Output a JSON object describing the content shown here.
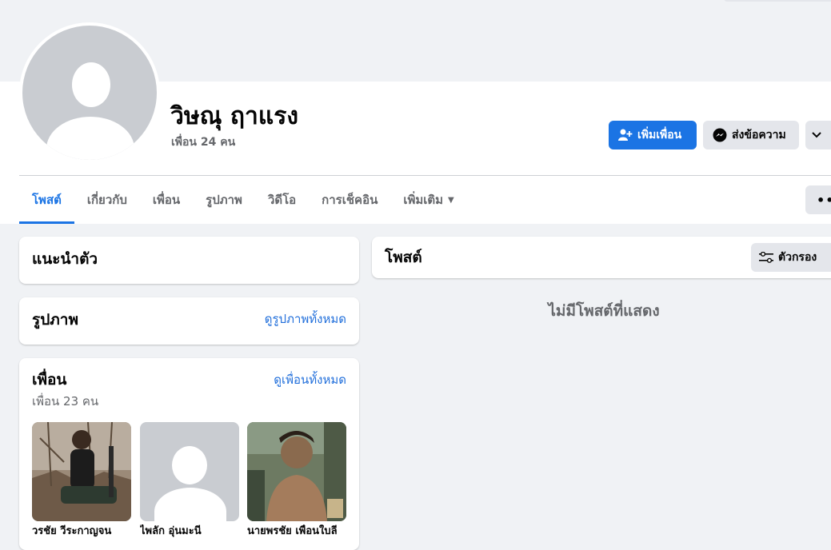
{
  "profile": {
    "name": "วิษณุ ฤาแรง",
    "friends_count": "เพื่อน 24 คน"
  },
  "actions": {
    "add_friend": "เพิ่มเพื่อน",
    "message": "ส่งข้อความ"
  },
  "tabs": [
    {
      "label": "โพสต์"
    },
    {
      "label": "เกี่ยวกับ"
    },
    {
      "label": "เพื่อน"
    },
    {
      "label": "รูปภาพ"
    },
    {
      "label": "วิดีโอ"
    },
    {
      "label": "การเช็คอิน"
    },
    {
      "label": "เพิ่มเติม"
    }
  ],
  "intro": {
    "title": "แนะนำตัว"
  },
  "photos": {
    "title": "รูปภาพ",
    "see_all": "ดูรูปภาพทั้งหมด"
  },
  "friends": {
    "title": "เพื่อน",
    "see_all": "ดูเพื่อนทั้งหมด",
    "subtitle": "เพื่อน 23 คน",
    "list": [
      {
        "name": "วรชัย วีระกาญจน"
      },
      {
        "name": "ไพลัก อุ่นมะนี"
      },
      {
        "name": "นายพรชัย เพื่อนใบลี"
      }
    ]
  },
  "posts": {
    "title": "โพสต์",
    "filter": "ตัวกรอง",
    "empty": "ไม่มีโพสต์ที่แสดง"
  },
  "colors": {
    "accent": "#1b74e4",
    "background": "#f0f2f5",
    "secondary_text": "#65676b"
  }
}
